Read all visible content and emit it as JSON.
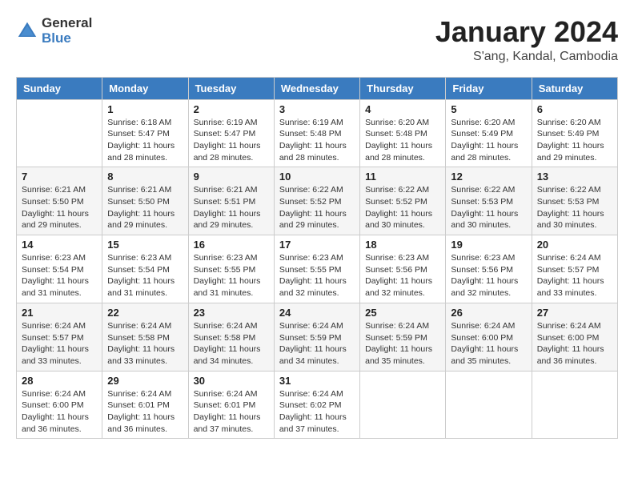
{
  "logo": {
    "text_general": "General",
    "text_blue": "Blue"
  },
  "title": "January 2024",
  "subtitle": "S'ang, Kandal, Cambodia",
  "days_of_week": [
    "Sunday",
    "Monday",
    "Tuesday",
    "Wednesday",
    "Thursday",
    "Friday",
    "Saturday"
  ],
  "weeks": [
    [
      {
        "day": "",
        "info": ""
      },
      {
        "day": "1",
        "info": "Sunrise: 6:18 AM\nSunset: 5:47 PM\nDaylight: 11 hours\nand 28 minutes."
      },
      {
        "day": "2",
        "info": "Sunrise: 6:19 AM\nSunset: 5:47 PM\nDaylight: 11 hours\nand 28 minutes."
      },
      {
        "day": "3",
        "info": "Sunrise: 6:19 AM\nSunset: 5:48 PM\nDaylight: 11 hours\nand 28 minutes."
      },
      {
        "day": "4",
        "info": "Sunrise: 6:20 AM\nSunset: 5:48 PM\nDaylight: 11 hours\nand 28 minutes."
      },
      {
        "day": "5",
        "info": "Sunrise: 6:20 AM\nSunset: 5:49 PM\nDaylight: 11 hours\nand 28 minutes."
      },
      {
        "day": "6",
        "info": "Sunrise: 6:20 AM\nSunset: 5:49 PM\nDaylight: 11 hours\nand 29 minutes."
      }
    ],
    [
      {
        "day": "7",
        "info": "Sunrise: 6:21 AM\nSunset: 5:50 PM\nDaylight: 11 hours\nand 29 minutes."
      },
      {
        "day": "8",
        "info": "Sunrise: 6:21 AM\nSunset: 5:50 PM\nDaylight: 11 hours\nand 29 minutes."
      },
      {
        "day": "9",
        "info": "Sunrise: 6:21 AM\nSunset: 5:51 PM\nDaylight: 11 hours\nand 29 minutes."
      },
      {
        "day": "10",
        "info": "Sunrise: 6:22 AM\nSunset: 5:52 PM\nDaylight: 11 hours\nand 29 minutes."
      },
      {
        "day": "11",
        "info": "Sunrise: 6:22 AM\nSunset: 5:52 PM\nDaylight: 11 hours\nand 30 minutes."
      },
      {
        "day": "12",
        "info": "Sunrise: 6:22 AM\nSunset: 5:53 PM\nDaylight: 11 hours\nand 30 minutes."
      },
      {
        "day": "13",
        "info": "Sunrise: 6:22 AM\nSunset: 5:53 PM\nDaylight: 11 hours\nand 30 minutes."
      }
    ],
    [
      {
        "day": "14",
        "info": "Sunrise: 6:23 AM\nSunset: 5:54 PM\nDaylight: 11 hours\nand 31 minutes."
      },
      {
        "day": "15",
        "info": "Sunrise: 6:23 AM\nSunset: 5:54 PM\nDaylight: 11 hours\nand 31 minutes."
      },
      {
        "day": "16",
        "info": "Sunrise: 6:23 AM\nSunset: 5:55 PM\nDaylight: 11 hours\nand 31 minutes."
      },
      {
        "day": "17",
        "info": "Sunrise: 6:23 AM\nSunset: 5:55 PM\nDaylight: 11 hours\nand 32 minutes."
      },
      {
        "day": "18",
        "info": "Sunrise: 6:23 AM\nSunset: 5:56 PM\nDaylight: 11 hours\nand 32 minutes."
      },
      {
        "day": "19",
        "info": "Sunrise: 6:23 AM\nSunset: 5:56 PM\nDaylight: 11 hours\nand 32 minutes."
      },
      {
        "day": "20",
        "info": "Sunrise: 6:24 AM\nSunset: 5:57 PM\nDaylight: 11 hours\nand 33 minutes."
      }
    ],
    [
      {
        "day": "21",
        "info": "Sunrise: 6:24 AM\nSunset: 5:57 PM\nDaylight: 11 hours\nand 33 minutes."
      },
      {
        "day": "22",
        "info": "Sunrise: 6:24 AM\nSunset: 5:58 PM\nDaylight: 11 hours\nand 33 minutes."
      },
      {
        "day": "23",
        "info": "Sunrise: 6:24 AM\nSunset: 5:58 PM\nDaylight: 11 hours\nand 34 minutes."
      },
      {
        "day": "24",
        "info": "Sunrise: 6:24 AM\nSunset: 5:59 PM\nDaylight: 11 hours\nand 34 minutes."
      },
      {
        "day": "25",
        "info": "Sunrise: 6:24 AM\nSunset: 5:59 PM\nDaylight: 11 hours\nand 35 minutes."
      },
      {
        "day": "26",
        "info": "Sunrise: 6:24 AM\nSunset: 6:00 PM\nDaylight: 11 hours\nand 35 minutes."
      },
      {
        "day": "27",
        "info": "Sunrise: 6:24 AM\nSunset: 6:00 PM\nDaylight: 11 hours\nand 36 minutes."
      }
    ],
    [
      {
        "day": "28",
        "info": "Sunrise: 6:24 AM\nSunset: 6:00 PM\nDaylight: 11 hours\nand 36 minutes."
      },
      {
        "day": "29",
        "info": "Sunrise: 6:24 AM\nSunset: 6:01 PM\nDaylight: 11 hours\nand 36 minutes."
      },
      {
        "day": "30",
        "info": "Sunrise: 6:24 AM\nSunset: 6:01 PM\nDaylight: 11 hours\nand 37 minutes."
      },
      {
        "day": "31",
        "info": "Sunrise: 6:24 AM\nSunset: 6:02 PM\nDaylight: 11 hours\nand 37 minutes."
      },
      {
        "day": "",
        "info": ""
      },
      {
        "day": "",
        "info": ""
      },
      {
        "day": "",
        "info": ""
      }
    ]
  ]
}
